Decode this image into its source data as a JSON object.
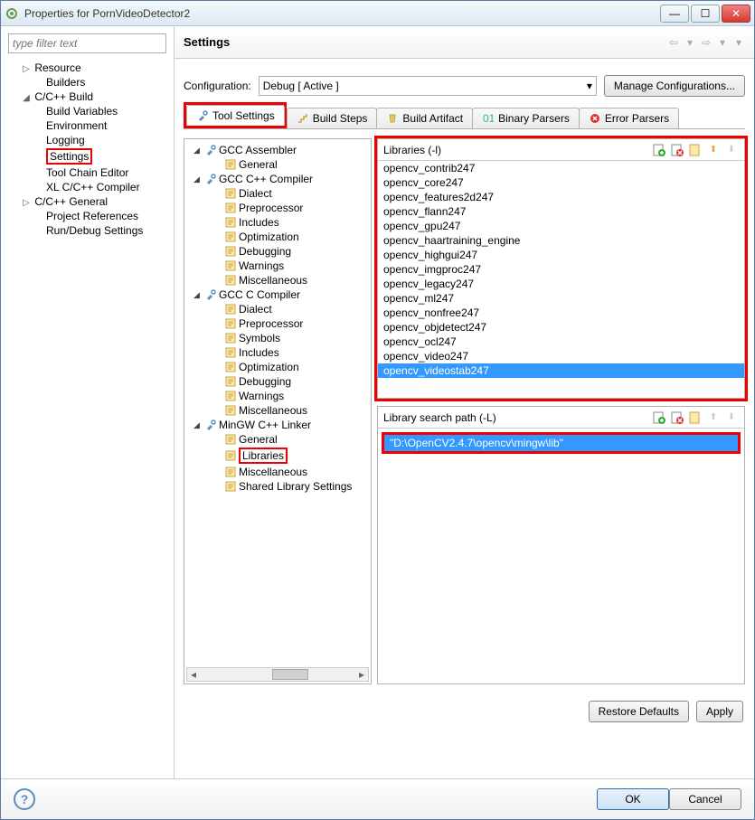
{
  "window": {
    "title": "Properties for PornVideoDetector2",
    "min_label": "—",
    "max_label": "▢",
    "close_label": "✕"
  },
  "filter_placeholder": "type filter text",
  "left_tree": [
    {
      "label": "Resource",
      "expand": "▷",
      "indent": 1
    },
    {
      "label": "Builders",
      "expand": "",
      "indent": 2
    },
    {
      "label": "C/C++ Build",
      "expand": "◢",
      "indent": 1
    },
    {
      "label": "Build Variables",
      "expand": "",
      "indent": 2
    },
    {
      "label": "Environment",
      "expand": "",
      "indent": 2
    },
    {
      "label": "Logging",
      "expand": "",
      "indent": 2
    },
    {
      "label": "Settings",
      "expand": "",
      "indent": 2,
      "boxed": true
    },
    {
      "label": "Tool Chain Editor",
      "expand": "",
      "indent": 2
    },
    {
      "label": "XL C/C++ Compiler",
      "expand": "",
      "indent": 2
    },
    {
      "label": "C/C++ General",
      "expand": "▷",
      "indent": 1
    },
    {
      "label": "Project References",
      "expand": "",
      "indent": 2
    },
    {
      "label": "Run/Debug Settings",
      "expand": "",
      "indent": 2
    }
  ],
  "header_title": "Settings",
  "config_label": "Configuration:",
  "config_value": "Debug  [ Active ]",
  "manage_btn": "Manage Configurations...",
  "tabs": [
    {
      "label": "Tool Settings",
      "active": true,
      "icon": "wrench",
      "boxed": true
    },
    {
      "label": "Build Steps",
      "icon": "steps"
    },
    {
      "label": "Build Artifact",
      "icon": "cup"
    },
    {
      "label": "Binary Parsers",
      "icon": "binary"
    },
    {
      "label": "Error Parsers",
      "icon": "error"
    }
  ],
  "tool_tree": [
    {
      "arrow": "◢",
      "icon": "tool",
      "label": "GCC Assembler",
      "indent": 0
    },
    {
      "arrow": "",
      "icon": "page",
      "label": "General",
      "indent": 1
    },
    {
      "arrow": "◢",
      "icon": "tool",
      "label": "GCC C++ Compiler",
      "indent": 0
    },
    {
      "arrow": "",
      "icon": "page",
      "label": "Dialect",
      "indent": 1
    },
    {
      "arrow": "",
      "icon": "page",
      "label": "Preprocessor",
      "indent": 1
    },
    {
      "arrow": "",
      "icon": "page",
      "label": "Includes",
      "indent": 1
    },
    {
      "arrow": "",
      "icon": "page",
      "label": "Optimization",
      "indent": 1
    },
    {
      "arrow": "",
      "icon": "page",
      "label": "Debugging",
      "indent": 1
    },
    {
      "arrow": "",
      "icon": "page",
      "label": "Warnings",
      "indent": 1
    },
    {
      "arrow": "",
      "icon": "page",
      "label": "Miscellaneous",
      "indent": 1
    },
    {
      "arrow": "◢",
      "icon": "tool",
      "label": "GCC C Compiler",
      "indent": 0
    },
    {
      "arrow": "",
      "icon": "page",
      "label": "Dialect",
      "indent": 1
    },
    {
      "arrow": "",
      "icon": "page",
      "label": "Preprocessor",
      "indent": 1
    },
    {
      "arrow": "",
      "icon": "page",
      "label": "Symbols",
      "indent": 1
    },
    {
      "arrow": "",
      "icon": "page",
      "label": "Includes",
      "indent": 1
    },
    {
      "arrow": "",
      "icon": "page",
      "label": "Optimization",
      "indent": 1
    },
    {
      "arrow": "",
      "icon": "page",
      "label": "Debugging",
      "indent": 1
    },
    {
      "arrow": "",
      "icon": "page",
      "label": "Warnings",
      "indent": 1
    },
    {
      "arrow": "",
      "icon": "page",
      "label": "Miscellaneous",
      "indent": 1
    },
    {
      "arrow": "◢",
      "icon": "tool",
      "label": "MinGW C++ Linker",
      "indent": 0
    },
    {
      "arrow": "",
      "icon": "page",
      "label": "General",
      "indent": 1
    },
    {
      "arrow": "",
      "icon": "page",
      "label": "Libraries",
      "indent": 1,
      "boxed": true
    },
    {
      "arrow": "",
      "icon": "page",
      "label": "Miscellaneous",
      "indent": 1
    },
    {
      "arrow": "",
      "icon": "page",
      "label": "Shared Library Settings",
      "indent": 1
    }
  ],
  "libs_header": "Libraries (-l)",
  "libs": [
    "opencv_contrib247",
    "opencv_core247",
    "opencv_features2d247",
    "opencv_flann247",
    "opencv_gpu247",
    "opencv_haartraining_engine",
    "opencv_highgui247",
    "opencv_imgproc247",
    "opencv_legacy247",
    "opencv_ml247",
    "opencv_nonfree247",
    "opencv_objdetect247",
    "opencv_ocl247",
    "opencv_video247",
    "opencv_videostab247"
  ],
  "libs_selected_index": 14,
  "paths_header": "Library search path (-L)",
  "paths": [
    "\"D:\\OpenCV2.4.7\\opencv\\mingw\\lib\""
  ],
  "footer": {
    "restore": "Restore Defaults",
    "apply": "Apply",
    "ok": "OK",
    "cancel": "Cancel"
  }
}
